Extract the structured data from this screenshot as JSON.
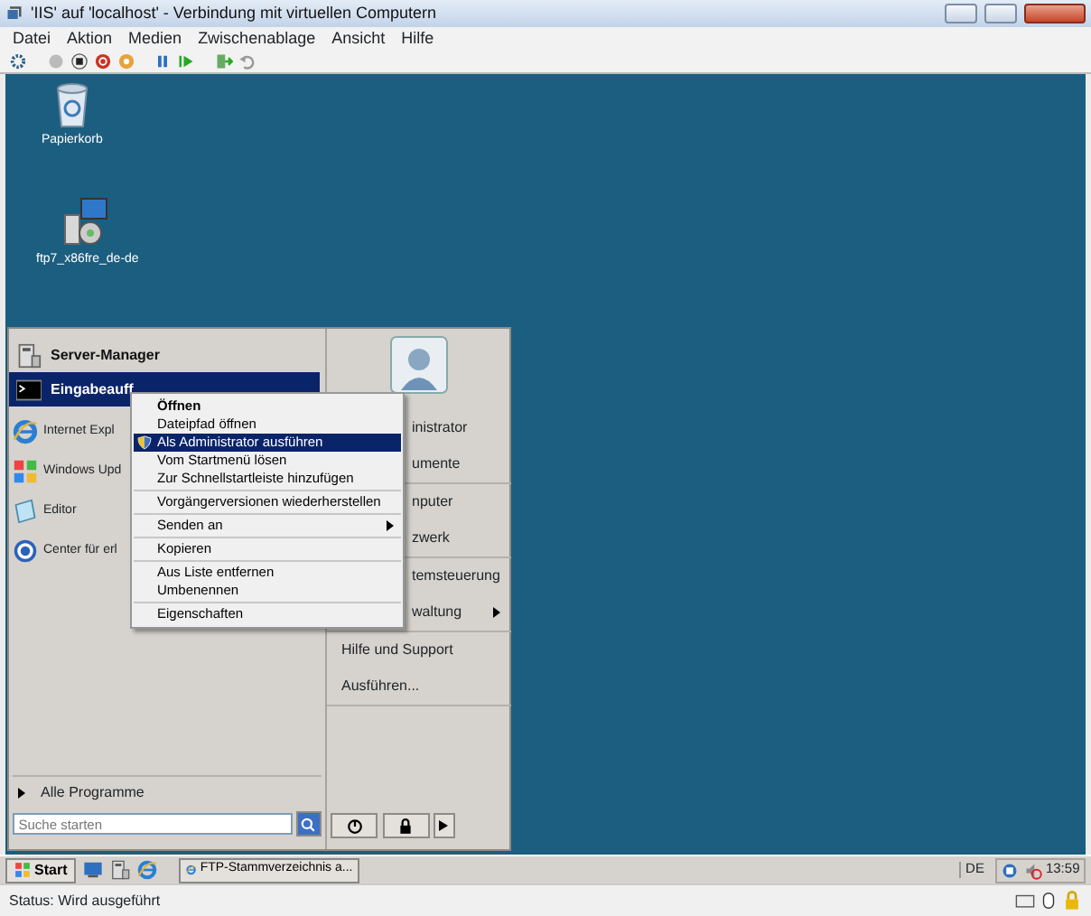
{
  "window": {
    "title": "'IIS' auf 'localhost' - Verbindung mit virtuellen Computern"
  },
  "menu_bar": [
    "Datei",
    "Aktion",
    "Medien",
    "Zwischenablage",
    "Ansicht",
    "Hilfe"
  ],
  "desktop_icons": [
    {
      "kind": "bin",
      "label": "Papierkorb"
    },
    {
      "kind": "installer",
      "label": "ftp7_x86fre_de-de"
    }
  ],
  "start_menu": {
    "pinned": [
      {
        "kind": "server",
        "label": "Server-Manager",
        "selected": false
      },
      {
        "kind": "console",
        "label": "Eingabeauff",
        "selected": true
      }
    ],
    "recent": [
      {
        "kind": "browser",
        "label": "Internet Expl"
      },
      {
        "kind": "update",
        "label": "Windows Upd"
      },
      {
        "kind": "editor",
        "label": "Editor"
      },
      {
        "kind": "center",
        "label": "Center für erl"
      }
    ],
    "all_programs": "Alle Programme",
    "search": {
      "placeholder": "Suche starten"
    },
    "right_groups": [
      [
        {
          "label": "inistrator",
          "submenu": false
        },
        {
          "label": "umente",
          "submenu": false
        }
      ],
      [
        {
          "label": "nputer",
          "submenu": false
        },
        {
          "label": "zwerk",
          "submenu": false
        }
      ],
      [
        {
          "label": "temsteuerung",
          "submenu": false
        },
        {
          "label": "waltung",
          "submenu": true
        }
      ],
      [
        {
          "label": "Hilfe und Support",
          "submenu": false
        },
        {
          "label": "Ausführen...",
          "submenu": false
        }
      ]
    ]
  },
  "context_menu": [
    [
      {
        "label": "Öffnen",
        "default": true,
        "selected": false,
        "shield": false,
        "submenu": false
      },
      {
        "label": "Dateipfad öffnen",
        "default": false,
        "selected": false,
        "shield": false,
        "submenu": false
      },
      {
        "label": "Als Administrator ausführen",
        "default": false,
        "selected": true,
        "shield": true,
        "submenu": false
      },
      {
        "label": "Vom Startmenü lösen",
        "default": false,
        "selected": false,
        "shield": false,
        "submenu": false
      },
      {
        "label": "Zur Schnellstartleiste hinzufügen",
        "default": false,
        "selected": false,
        "shield": false,
        "submenu": false
      }
    ],
    [
      {
        "label": "Vorgängerversionen wiederherstellen",
        "default": false,
        "selected": false,
        "shield": false,
        "submenu": false
      }
    ],
    [
      {
        "label": "Senden an",
        "default": false,
        "selected": false,
        "shield": false,
        "submenu": true
      }
    ],
    [
      {
        "label": "Kopieren",
        "default": false,
        "selected": false,
        "shield": false,
        "submenu": false
      }
    ],
    [
      {
        "label": "Aus Liste entfernen",
        "default": false,
        "selected": false,
        "shield": false,
        "submenu": false
      },
      {
        "label": "Umbenennen",
        "default": false,
        "selected": false,
        "shield": false,
        "submenu": false
      }
    ],
    [
      {
        "label": "Eigenschaften",
        "default": false,
        "selected": false,
        "shield": false,
        "submenu": false
      }
    ]
  ],
  "taskbar": {
    "start": "Start",
    "tasks": [
      "FTP-Stammverzeichnis a..."
    ],
    "language": "DE",
    "clock": "13:59"
  },
  "status_bar": "Status: Wird ausgeführt"
}
